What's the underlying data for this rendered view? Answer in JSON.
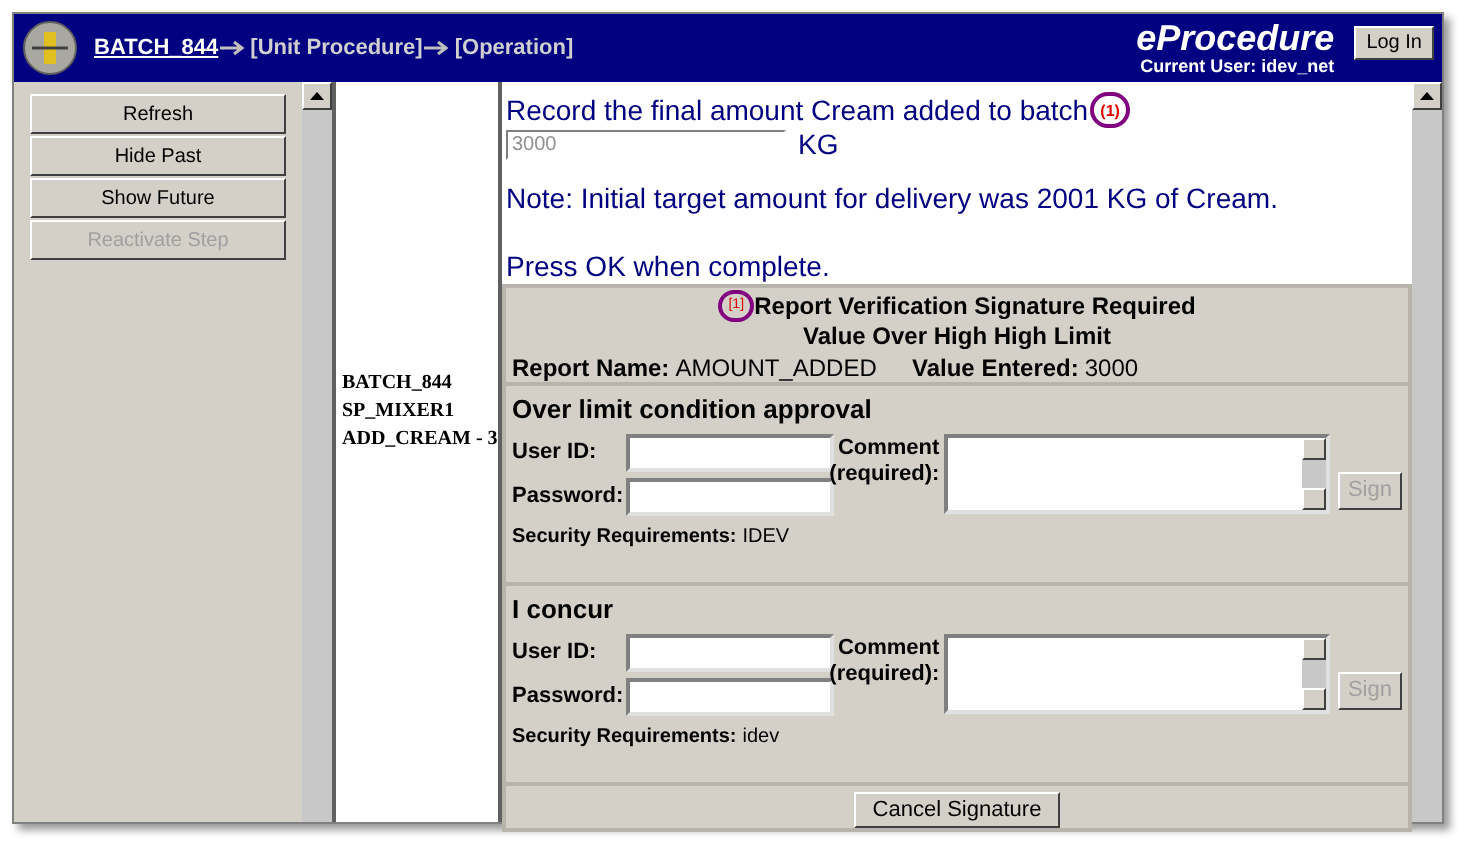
{
  "header": {
    "breadcrumb": [
      {
        "label": "BATCH_844",
        "link": true
      },
      {
        "label": "[Unit Procedure]",
        "link": false
      },
      {
        "label": "[Operation]",
        "link": false
      }
    ],
    "brand": "eProcedure",
    "current_user": "Current User: idev_net",
    "login_button": "Log In"
  },
  "sidebar": {
    "buttons": [
      {
        "label": "Refresh",
        "disabled": false
      },
      {
        "label": "Hide Past",
        "disabled": false
      },
      {
        "label": "Show Future",
        "disabled": false
      },
      {
        "label": "Reactivate Step",
        "disabled": true
      }
    ]
  },
  "step_info": [
    "BATCH_844",
    "SP_MIXER1",
    "ADD_CREAM - 3"
  ],
  "instruction": {
    "prompt": "Record the final amount Cream added to batch",
    "callout": "(1)",
    "value": "3000",
    "unit": "KG",
    "note": "Note: Initial target amount for delivery was 2001 KG of Cream.",
    "press_ok": "Press OK when complete."
  },
  "signature": {
    "callout": "[1]",
    "title": "Report Verification Signature Required",
    "subtitle": "Value Over High High Limit",
    "report_name_label": "Report Name:",
    "report_name": "AMOUNT_ADDED",
    "value_entered_label": "Value Entered:",
    "value_entered": "3000",
    "sections": [
      {
        "title": "Over limit condition approval",
        "user_id_label": "User ID:",
        "password_label": "Password:",
        "comment_label": "Comment",
        "comment_required": "(required):",
        "security_label": "Security Requirements:",
        "security_value": "IDEV",
        "sign_button": "Sign",
        "sign_disabled": true
      },
      {
        "title": "I concur",
        "user_id_label": "User ID:",
        "password_label": "Password:",
        "comment_label": "Comment",
        "comment_required": "(required):",
        "security_label": "Security Requirements:",
        "security_value": "idev",
        "sign_button": "Sign",
        "sign_disabled": true
      }
    ],
    "cancel_button": "Cancel Signature"
  }
}
